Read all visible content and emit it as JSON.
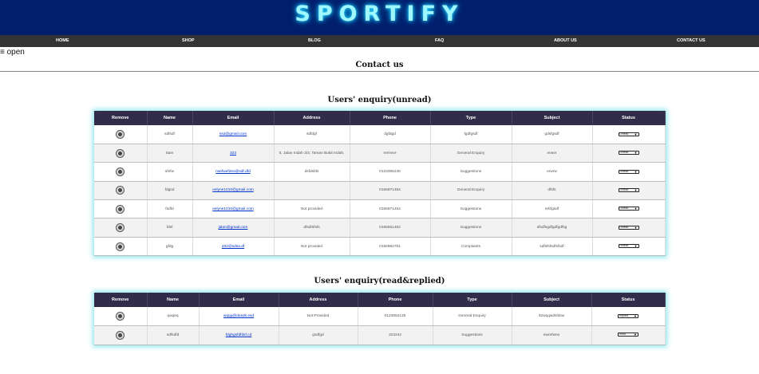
{
  "header": {
    "logo": "SPORTIFY"
  },
  "nav": [
    "HOME",
    "SHOP",
    "BLOG",
    "FAQ",
    "ABOUT US",
    "CONTACT US"
  ],
  "toggle": {
    "icon": "≡",
    "label": "open"
  },
  "page_title": "Contact us",
  "unread": {
    "title": "Users' enquiry(unread)",
    "columns": [
      "Remove",
      "Name",
      "Email",
      "Address",
      "Phone",
      "Type",
      "Subject",
      "Status"
    ],
    "rows": [
      {
        "name": "sdfsdf",
        "email": "ssd@gmail.com",
        "address": "sdfdgf",
        "phone": "dgfdgd",
        "type": "fgdfgsdf",
        "subject": "gdsfgsdf",
        "status": "Unread"
      },
      {
        "name": "Sam",
        "email": "323",
        "address": "5, Jalan Indah 3/3, Taman Bukit Indah,",
        "phone": "rerrrere",
        "type": "General Enquiry",
        "subject": "erwer",
        "status": "Unread"
      },
      {
        "name": "sfefw",
        "email": "rwefwef2es@sdf.dfd",
        "address": "dsfdsfds",
        "phone": "0123365245",
        "type": "Suggestions",
        "subject": "erwrw",
        "status": "Unread"
      },
      {
        "name": "fdgsd",
        "email": "eelyne1010@gmail.com",
        "address": "",
        "phone": "0165871452",
        "type": "General Enquiry",
        "subject": "dfsfs",
        "status": "Unread"
      },
      {
        "name": "fsdfd",
        "email": "eelyne1010@gmail.com",
        "address": "Not provided",
        "phone": "0165871452",
        "type": "Suggestions",
        "subject": "refdgsdf",
        "status": "Unread"
      },
      {
        "name": "fdsf",
        "email": "jalan@gmail.com",
        "address": "dfsdfsfsfs",
        "phone": "0165551452",
        "type": "Suggestions",
        "subject": "sfsdfsgdfgdfgdfsg",
        "status": "Unread"
      },
      {
        "name": "gfdg",
        "email": "232@sdsa.df",
        "address": "Not provided",
        "phone": "0156984751",
        "type": "Complaints",
        "subject": "sdfsfsfsdfsfsdf",
        "status": "Unread"
      }
    ]
  },
  "read": {
    "title": "Users' enquiry(read&replied)",
    "columns": [
      "Remove",
      "Name",
      "Email",
      "Address",
      "Phone",
      "Type",
      "Subject",
      "Status"
    ],
    "rows": [
      {
        "name": "qwqeq",
        "email": "wqqq@dasds.esd",
        "address": "Not Provided",
        "phone": "0123654125",
        "type": "General Enquiry",
        "subject": "32wqqwdsfdsw",
        "status": "Replied"
      },
      {
        "name": "sdfsdfd",
        "email": "fdghgsfdfdsf.cd",
        "address": "gsdfgd",
        "phone": "323242",
        "type": "Suggestions",
        "subject": "ewrefwrw",
        "status": "Read"
      }
    ]
  }
}
